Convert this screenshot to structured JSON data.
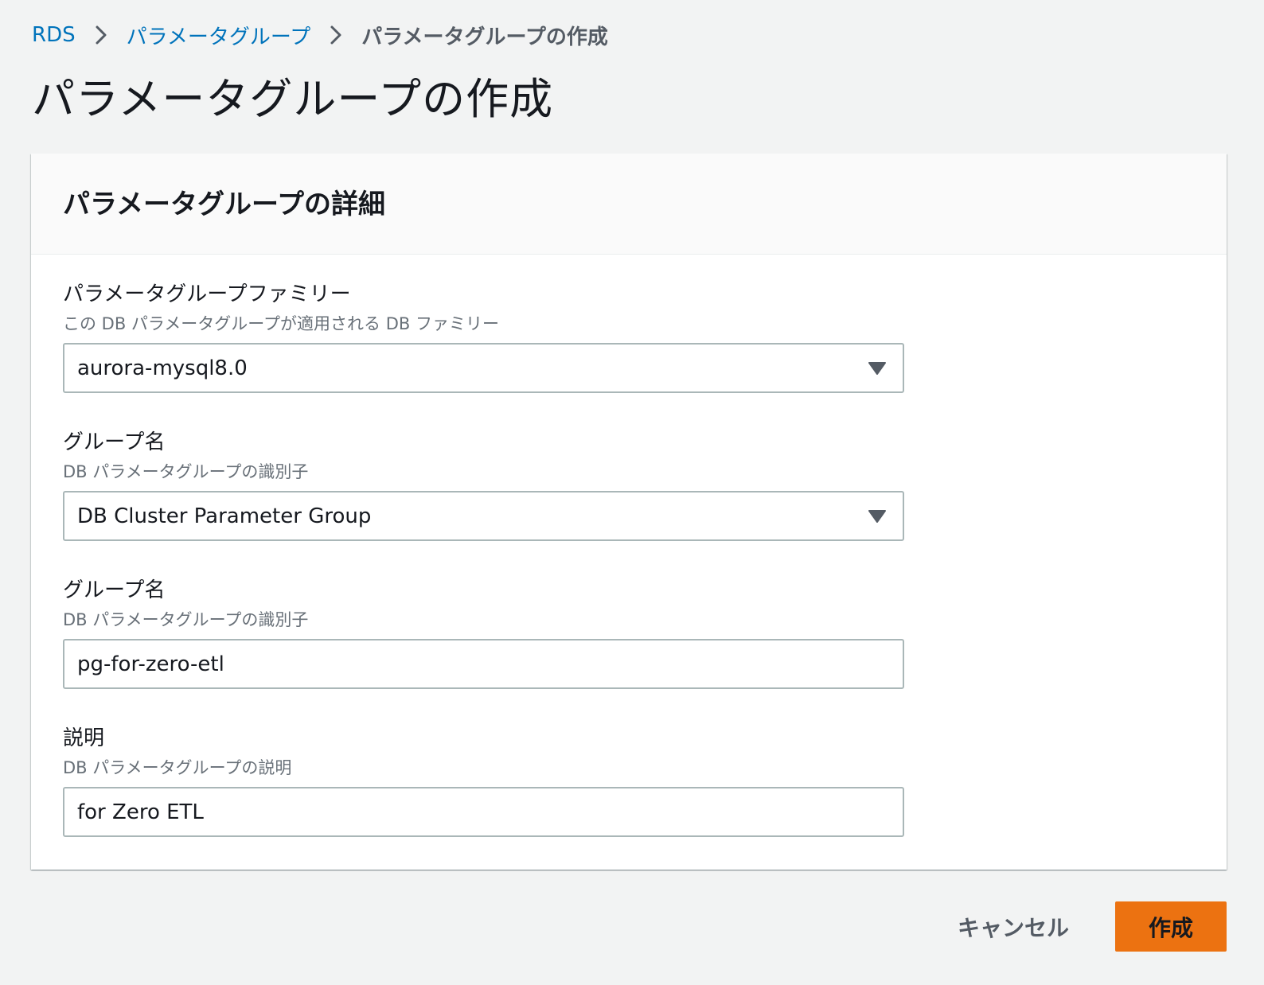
{
  "breadcrumb": {
    "items": [
      {
        "label": "RDS"
      },
      {
        "label": "パラメータグループ"
      }
    ],
    "current": "パラメータグループの作成"
  },
  "page": {
    "title": "パラメータグループの作成"
  },
  "panel": {
    "title": "パラメータグループの詳細",
    "fields": [
      {
        "label": "パラメータグループファミリー",
        "description": "この DB パラメータグループが適用される DB ファミリー",
        "type": "select",
        "value": "aurora-mysql8.0"
      },
      {
        "label": "グループ名",
        "description": "DB パラメータグループの識別子",
        "type": "select",
        "value": "DB Cluster Parameter Group"
      },
      {
        "label": "グループ名",
        "description": "DB パラメータグループの識別子",
        "type": "text",
        "value": "pg-for-zero-etl"
      },
      {
        "label": "説明",
        "description": "DB パラメータグループの説明",
        "type": "text",
        "value": "for Zero ETL"
      }
    ]
  },
  "actions": {
    "cancel_label": "キャンセル",
    "create_label": "作成"
  },
  "colors": {
    "link": "#0073bb",
    "primary_button": "#ec7211",
    "background": "#f2f3f3",
    "input_border": "#aab7b8"
  },
  "icons": {
    "breadcrumb_separator": "chevron-right-icon",
    "select_caret": "caret-down-icon"
  }
}
